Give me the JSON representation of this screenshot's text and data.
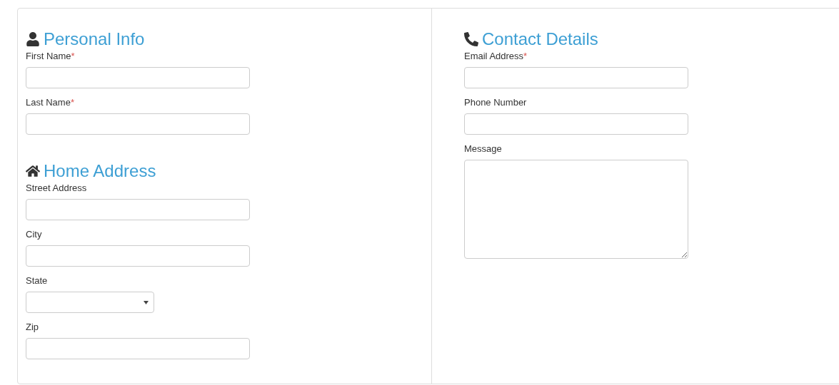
{
  "columns": [
    {
      "sections": [
        {
          "kind": "user",
          "title": "Personal Info",
          "fields": [
            {
              "kind": "text",
              "label": "First Name",
              "marker": "*"
            },
            {
              "kind": "text",
              "label": "Last Name",
              "marker": "*"
            }
          ]
        },
        {
          "kind": "home",
          "title": "Home Address",
          "fields": [
            {
              "kind": "text",
              "label": "Street Address"
            },
            {
              "kind": "text",
              "label": "City"
            },
            {
              "kind": "select",
              "label": "State"
            },
            {
              "kind": "text",
              "label": "Zip"
            }
          ]
        }
      ]
    },
    {
      "sections": [
        {
          "kind": "phone",
          "title": "Contact Details",
          "fields": [
            {
              "kind": "text",
              "label": "Email Address",
              "marker": "*"
            },
            {
              "kind": "text",
              "label": "Phone Number"
            },
            {
              "kind": "textarea",
              "label": "Message"
            }
          ]
        }
      ]
    }
  ]
}
